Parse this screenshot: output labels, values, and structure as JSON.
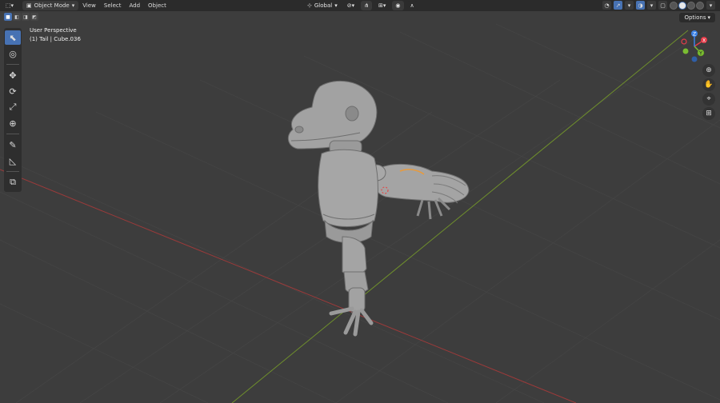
{
  "header": {
    "editor_type_icon": "cube-icon",
    "mode": "Object Mode",
    "menu": [
      "View",
      "Select",
      "Add",
      "Object"
    ],
    "transform_orientation": "Global",
    "pivot_icon": "pivot-icon",
    "snap_icon": "magnet-icon",
    "proportional_icon": "proportional-edit-icon"
  },
  "tool_header": {
    "select_modes": [
      "new",
      "extend",
      "subtract",
      "invert"
    ]
  },
  "options_label": "Options",
  "viewport": {
    "perspective_label": "User Perspective",
    "active_object_label": "(1) Tail | Cube.036"
  },
  "toolbar": {
    "tools": [
      "select-box",
      "cursor",
      "move",
      "rotate",
      "scale",
      "transform",
      "annotate",
      "measure",
      "add-cube"
    ]
  },
  "gizmo": {
    "axes": [
      "X",
      "Y",
      "Z"
    ],
    "colors": {
      "x": "#e63c4a",
      "y": "#7bbd32",
      "z": "#3b82e6"
    }
  },
  "nav_tools": [
    "zoom-icon",
    "pan-hand-icon",
    "camera-icon",
    "grid-icon"
  ],
  "colors": {
    "background": "#3d3d3d",
    "header": "#2b2b2b",
    "accent": "#4772b3",
    "x_axis_line": "#9c3a3a",
    "y_axis_line": "#6f8f2c"
  }
}
